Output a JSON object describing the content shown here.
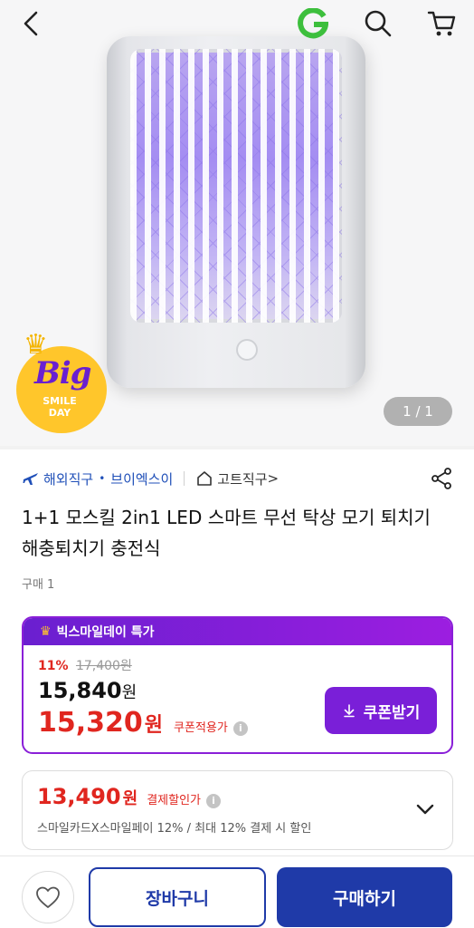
{
  "header": {
    "back_icon": "chevron-left-icon",
    "brand_icon": "gmarket-g-icon",
    "search_icon": "search-icon",
    "cart_icon": "cart-icon",
    "brand_color": "#3dbf3d"
  },
  "hero": {
    "badge": {
      "big": "Big",
      "smile": "SMILE",
      "day": "DAY"
    },
    "page_counter": "1 / 1"
  },
  "seller": {
    "overseas_label": "해외직구",
    "store_name": "브이엑스이",
    "home_link": "고트직구",
    "home_link_arrow": ">"
  },
  "product": {
    "title": "1+1 모스킬 2in1 LED 스마트 무선 탁상 모기 퇴치기 해충퇴치기 충전식",
    "purchase_count": "구매 1"
  },
  "deal": {
    "header_label": "빅스마일데이 특가",
    "discount_rate": "11%",
    "original_price": "17,400원",
    "price_value": "15,840",
    "price_unit": "원",
    "coupon_price_value": "15,320",
    "coupon_price_unit": "원",
    "coupon_price_label": "쿠폰적용가",
    "coupon_button_label": "쿠폰받기",
    "accent_color": "#7a1fd8",
    "sale_color": "#e0261f"
  },
  "payment": {
    "price_value": "13,490",
    "price_unit": "원",
    "label": "결제할인가",
    "description": "스마일카드X스마일페이 12% / 최대 12% 결제 시 할인"
  },
  "bottom_bar": {
    "cart_label": "장바구니",
    "buy_label": "구매하기",
    "button_color": "#1f3aa8"
  }
}
